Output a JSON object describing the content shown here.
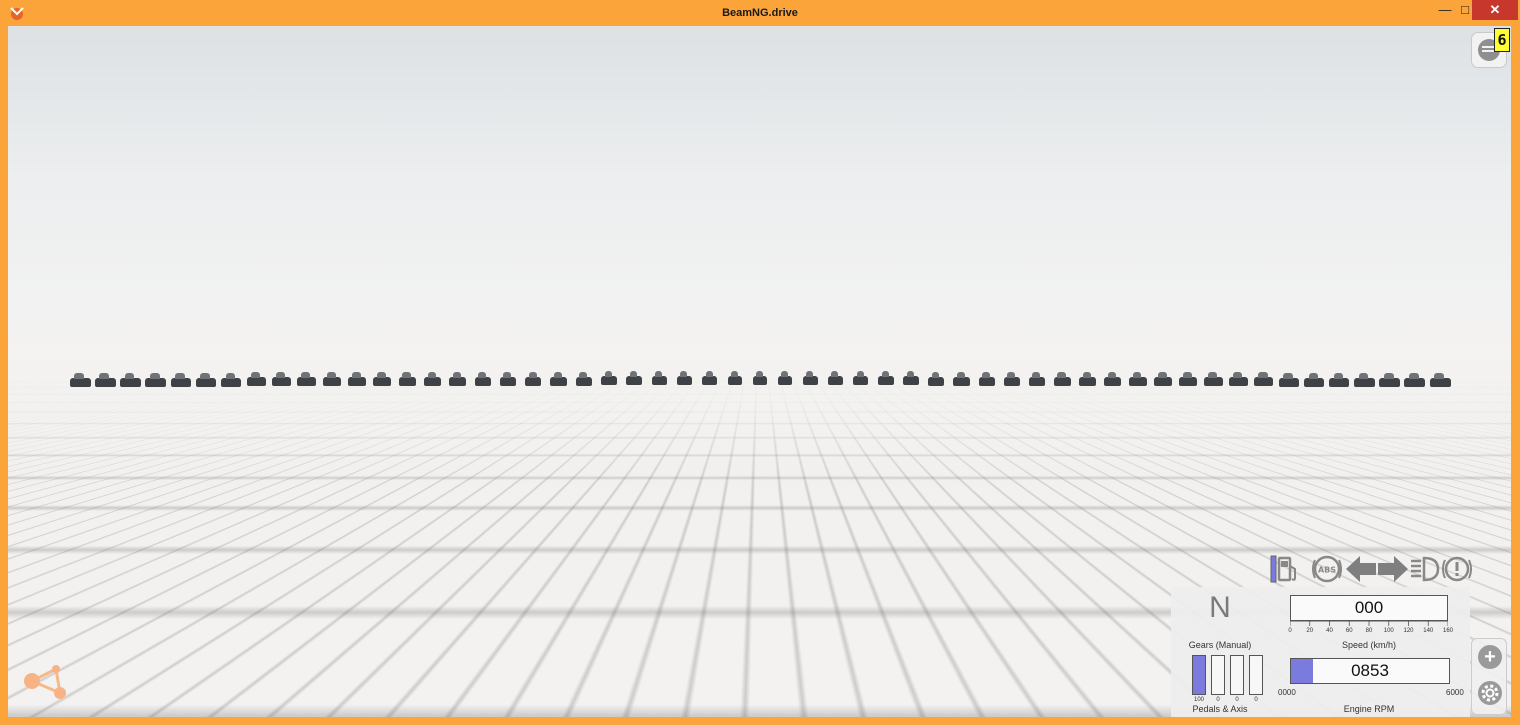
{
  "window": {
    "title": "BeamNG.drive",
    "controls": {
      "minimize": "—",
      "maximize": "□",
      "close": "✕"
    },
    "accent_color": "#fba43a"
  },
  "hud": {
    "fps_badge": "6",
    "menu_icon": "menu-icon",
    "indicators": [
      "fuel-icon",
      "abs-icon",
      "left-turn-signal-icon",
      "right-turn-signal-icon",
      "headlight-icon",
      "warning-icon"
    ]
  },
  "dashboard": {
    "gear": "N",
    "gears_label": "Gears (Manual)",
    "speed_value": "000",
    "speed_ticks": [
      "0",
      "20",
      "40",
      "60",
      "80",
      "100",
      "120",
      "140",
      "160"
    ],
    "speed_label": "Speed (km/h)",
    "rpm_value": "0853",
    "rpm_min": "0000",
    "rpm_max": "6000",
    "rpm_fraction": 0.142,
    "rpm_label": "Engine RPM",
    "pedals": [
      {
        "value": "100",
        "level": 1.0
      },
      {
        "value": "0",
        "level": 0
      },
      {
        "value": "0",
        "level": 0
      },
      {
        "value": "0",
        "level": 0
      }
    ],
    "pedals_label": "Pedals & Axis",
    "fill_color": "#7b7bdd"
  },
  "side_buttons": {
    "add": "+",
    "settings": "settings-icon"
  },
  "scene": {
    "car_count": 55
  }
}
